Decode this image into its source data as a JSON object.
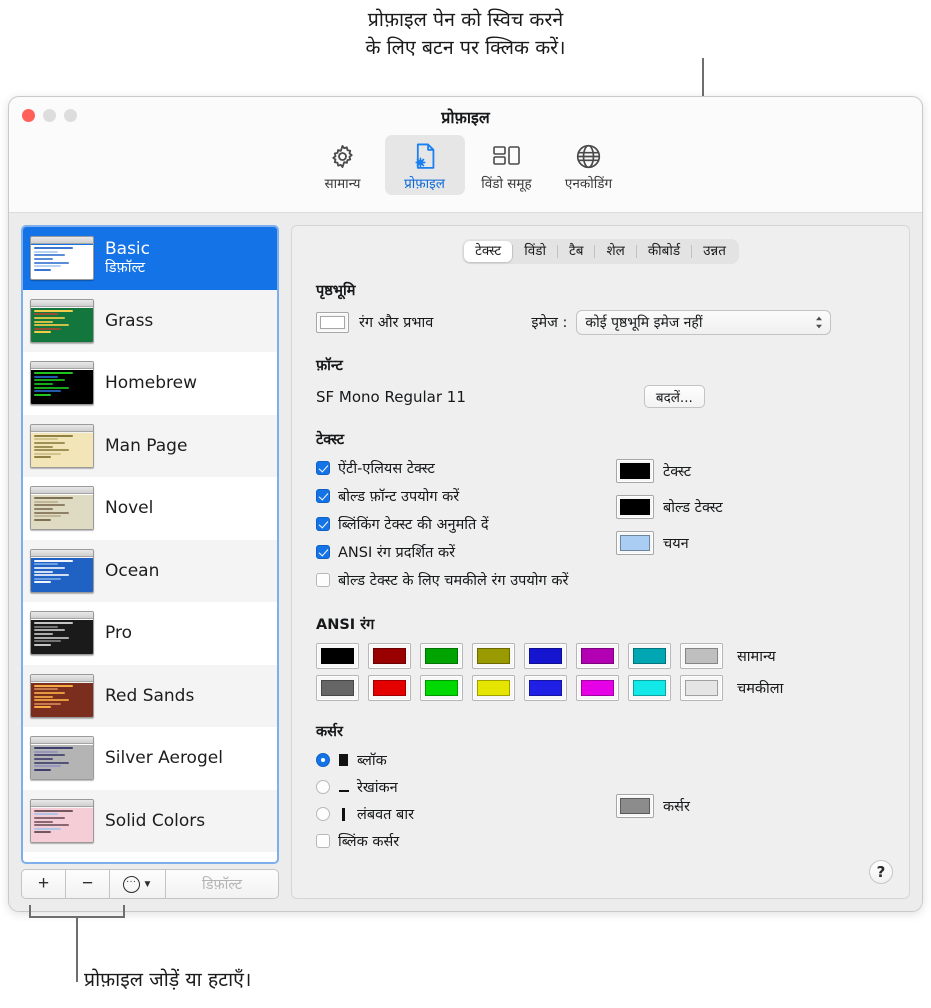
{
  "callouts": {
    "top": {
      "line1": "प्रोफ़ाइल पेन को स्विच करने",
      "line2": "के लिए बटन पर क्लिक करें।"
    },
    "bottom": {
      "line1": "प्रोफ़ाइल जोड़ें या हटाएँ।"
    }
  },
  "window": {
    "title": "प्रोफ़ाइल",
    "traffic_lights": [
      "close-red",
      "minimize-grey",
      "zoom-grey"
    ]
  },
  "toolbar": {
    "items": [
      {
        "label": "सामान्य",
        "icon": "gear-icon",
        "selected": false
      },
      {
        "label": "प्रोफ़ाइल",
        "icon": "profile-document-gear-icon",
        "selected": true
      },
      {
        "label": "विंडो समूह",
        "icon": "window-group-icon",
        "selected": false
      },
      {
        "label": "एनकोडिंग",
        "icon": "globe-icon",
        "selected": false
      }
    ]
  },
  "sidebar": {
    "profiles": [
      {
        "name": "Basic",
        "subtitle": "डिफ़ॉल्ट",
        "selected": true,
        "thumb": {
          "bg": "#ffffff",
          "fg": "#2f6fd0",
          "accent": "#a8c8ef"
        }
      },
      {
        "name": "Grass",
        "subtitle": "",
        "selected": false,
        "thumb": {
          "bg": "#13773d",
          "fg": "#ffd24a",
          "accent": "#b5442f"
        }
      },
      {
        "name": "Homebrew",
        "subtitle": "",
        "selected": false,
        "thumb": {
          "bg": "#000000",
          "fg": "#21d021",
          "accent": "#2b6fd4"
        }
      },
      {
        "name": "Man Page",
        "subtitle": "",
        "selected": false,
        "thumb": {
          "bg": "#f2e5b8",
          "fg": "#8a7a3d",
          "accent": "#c9bb84"
        }
      },
      {
        "name": "Novel",
        "subtitle": "",
        "selected": false,
        "thumb": {
          "bg": "#dfdbc3",
          "fg": "#7a6a4e",
          "accent": "#b9ad8a"
        }
      },
      {
        "name": "Ocean",
        "subtitle": "",
        "selected": false,
        "thumb": {
          "bg": "#2061c4",
          "fg": "#ffffff",
          "accent": "#7fb0ea"
        }
      },
      {
        "name": "Pro",
        "subtitle": "",
        "selected": false,
        "thumb": {
          "bg": "#1a1a1a",
          "fg": "#cfcfcf",
          "accent": "#8a8a8a"
        }
      },
      {
        "name": "Red Sands",
        "subtitle": "",
        "selected": false,
        "thumb": {
          "bg": "#7b2d1e",
          "fg": "#ffb347",
          "accent": "#d98b5b"
        }
      },
      {
        "name": "Silver Aerogel",
        "subtitle": "",
        "selected": false,
        "thumb": {
          "bg": "#b4b4b4",
          "fg": "#3a3a6a",
          "accent": "#8f8fc0"
        }
      },
      {
        "name": "Solid Colors",
        "subtitle": "",
        "selected": false,
        "thumb": {
          "bg": "#f4cdd6",
          "fg": "#6b4f57",
          "accent": "#9fc3e8"
        }
      }
    ],
    "toolbar": {
      "add_label": "+",
      "remove_label": "−",
      "options_label": "⋯",
      "options_chevron": "chevron-down-icon",
      "default_label": "डिफ़ॉल्ट"
    }
  },
  "pane": {
    "tabs": [
      {
        "label": "टेक्स्ट",
        "active": true
      },
      {
        "label": "विंडो",
        "active": false
      },
      {
        "label": "टैब",
        "active": false
      },
      {
        "label": "शेल",
        "active": false
      },
      {
        "label": "कीबोर्ड",
        "active": false
      },
      {
        "label": "उन्नत",
        "active": false
      }
    ],
    "background": {
      "title": "पृष्ठभूमि",
      "color_label": "रंग और प्रभाव",
      "color_value": "#ffffff",
      "image_label": "इमेज :",
      "image_value": "कोई पृष्ठभूमि इमेज नहीं"
    },
    "font": {
      "title": "फ़ॉन्ट",
      "value": "SF Mono Regular 11",
      "change_button": "बदलें..."
    },
    "text": {
      "title": "टेक्स्ट",
      "checkboxes": [
        {
          "label": "ऐंटी-एलियस टेक्स्ट",
          "checked": true
        },
        {
          "label": "बोल्ड फ़ॉन्ट उपयोग करें",
          "checked": true
        },
        {
          "label": "ब्लिंकिंग टेक्स्ट की अनुमति दें",
          "checked": true
        },
        {
          "label": "ANSI रंग प्रदर्शित करें",
          "checked": true
        },
        {
          "label": "बोल्ड टेक्स्ट के लिए चमकीले रंग उपयोग करें",
          "checked": false
        }
      ],
      "wells": [
        {
          "label": "टेक्स्ट",
          "color": "#000000"
        },
        {
          "label": "बोल्ड टेक्स्ट",
          "color": "#000000"
        },
        {
          "label": "चयन",
          "color": "#aacdf3"
        }
      ]
    },
    "ansi": {
      "title": "ANSI रंग",
      "normal_label": "सामान्य",
      "bright_label": "चमकीला",
      "normal": [
        "#000000",
        "#990000",
        "#00a400",
        "#999900",
        "#1515d0",
        "#b200b2",
        "#00a6b2",
        "#bfbfbf"
      ],
      "bright": [
        "#666666",
        "#e50000",
        "#00d900",
        "#e5e500",
        "#1f1fe5",
        "#e500e5",
        "#12e8e8",
        "#e5e5e5"
      ]
    },
    "cursor": {
      "title": "कर्सर",
      "options": [
        {
          "label": "ब्लॉक",
          "glyph": "block-cursor-icon",
          "selected": true
        },
        {
          "label": "रेखांकन",
          "glyph": "underline-cursor-icon",
          "selected": false
        },
        {
          "label": "लंबवत बार",
          "glyph": "vertical-bar-cursor-icon",
          "selected": false
        }
      ],
      "blink": {
        "label": "ब्लिंक कर्सर",
        "checked": false
      },
      "well": {
        "label": "कर्सर",
        "color": "#8c8c8c"
      }
    },
    "help_label": "?"
  }
}
